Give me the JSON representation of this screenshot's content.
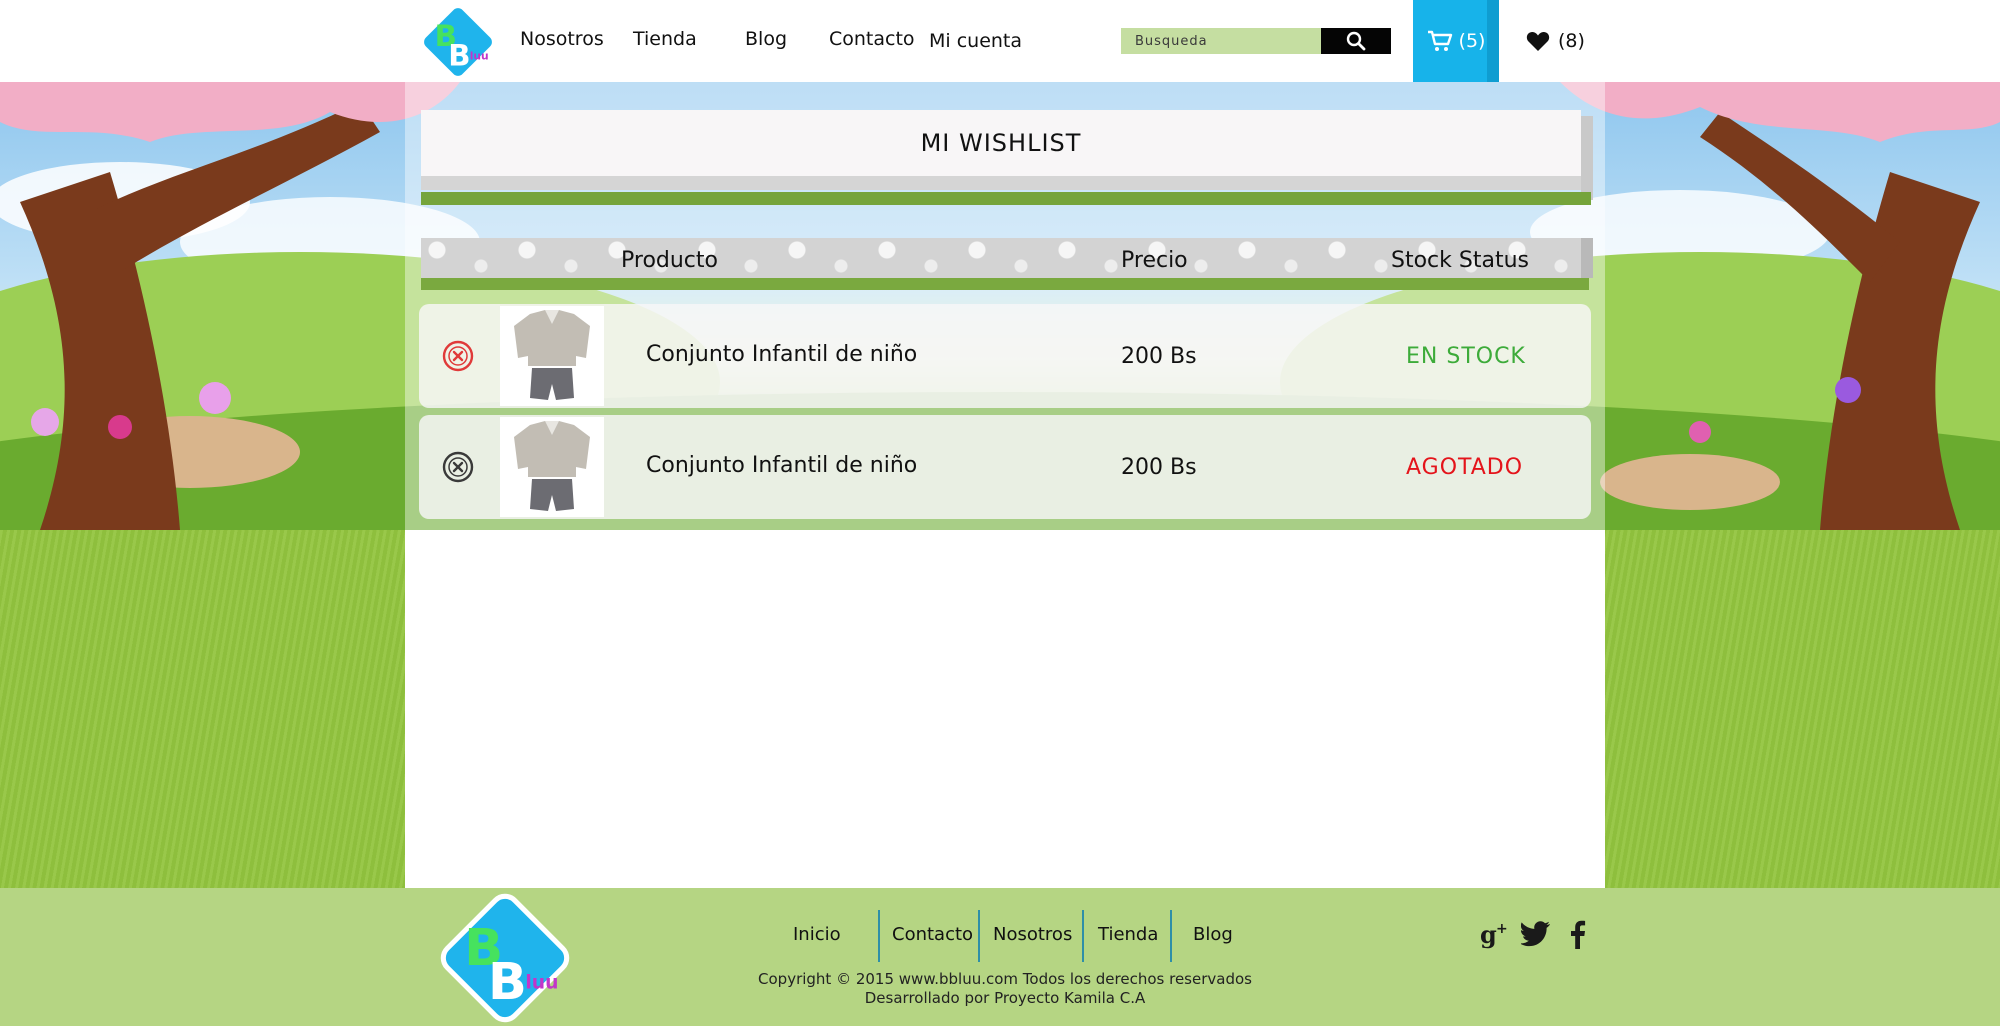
{
  "header": {
    "logo_text": "BBluu",
    "nav": [
      {
        "label": "Nosotros"
      },
      {
        "label": "Tienda"
      },
      {
        "label": "Blog"
      },
      {
        "label": "Contacto"
      },
      {
        "label": "Mi cuenta"
      }
    ],
    "search": {
      "placeholder": "Busqueda"
    },
    "cart": {
      "count": "(5)",
      "icon": "cart-icon"
    },
    "wishlist": {
      "count": "(8)",
      "icon": "heart-icon"
    }
  },
  "page": {
    "title": "MI WISHLIST"
  },
  "table": {
    "headers": [
      "Producto",
      "Precio",
      "Stock Status"
    ],
    "rows": [
      {
        "name": "Conjunto Infantil de niño",
        "price": "200 Bs",
        "status": "EN STOCK",
        "status_color": "#3dab3a",
        "remove_color": "#e03a3a"
      },
      {
        "name": "Conjunto Infantil de niño",
        "price": "200 Bs",
        "status": "AGOTADO",
        "status_color": "#e4141b",
        "remove_color": "#3a3a3a"
      }
    ]
  },
  "footer": {
    "links": [
      {
        "label": "Inicio"
      },
      {
        "label": "Contacto"
      },
      {
        "label": "Nosotros"
      },
      {
        "label": "Tienda"
      },
      {
        "label": "Blog"
      }
    ],
    "copyright": "Copyright © 2015 www.bbluu.com Todos los derechos reservados",
    "developer": "Desarrollado por Proyecto Kamila C.A",
    "social": [
      "google-plus-icon",
      "twitter-icon",
      "facebook-icon"
    ]
  },
  "colors": {
    "accent_blue": "#17b3ea",
    "accent_green": "#75a43b",
    "search_bg": "#c5dea1",
    "footer_bg": "#b5d583"
  }
}
